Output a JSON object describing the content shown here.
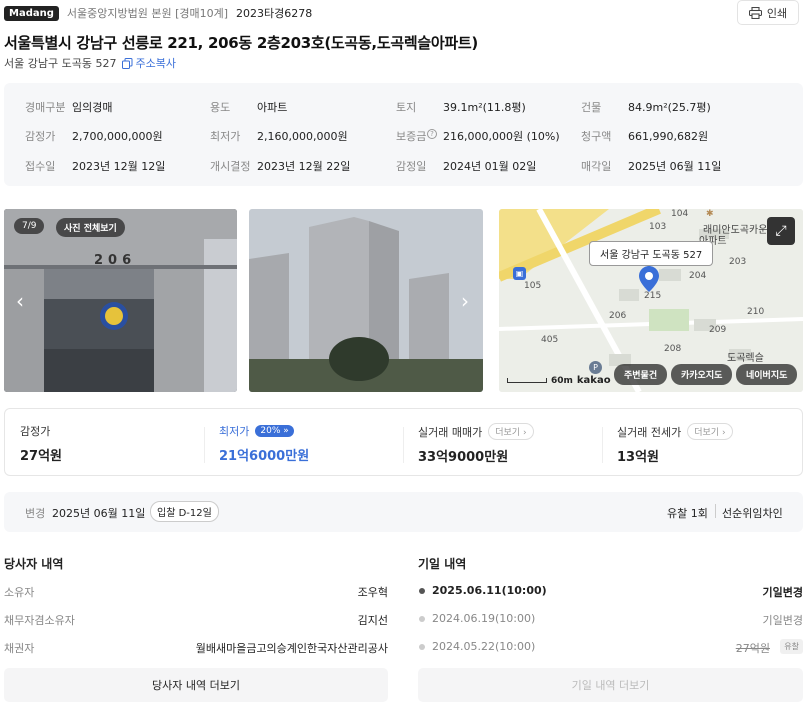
{
  "header": {
    "logo": "Madang",
    "court": "서울중앙지방법원 본원 [경매10계]",
    "case_no": "2023타경6278",
    "print_label": "인쇄",
    "title": "서울특별시 강남구 선릉로 221, 206동 2층203호(도곡동,도곡렉슬아파트)",
    "sub_address": "서울 강남구 도곡동 527",
    "copy_label": "주소복사"
  },
  "info": {
    "row1": [
      {
        "k": "경매구분",
        "v": "임의경매"
      },
      {
        "k": "용도",
        "v": "아파트"
      },
      {
        "k": "토지",
        "v": "39.1m²(11.8평)"
      },
      {
        "k": "건물",
        "v": "84.9m²(25.7평)"
      }
    ],
    "row2": [
      {
        "k": "감정가",
        "v": "2,700,000,000원"
      },
      {
        "k": "최저가",
        "v": "2,160,000,000원"
      },
      {
        "k": "보증금",
        "v": "216,000,000원 (10%)"
      },
      {
        "k": "청구액",
        "v": "661,990,682원"
      }
    ],
    "row3": [
      {
        "k": "접수일",
        "v": "2023년 12월 12일"
      },
      {
        "k": "개시결정",
        "v": "2023년 12월 22일"
      },
      {
        "k": "감정일",
        "v": "2024년 01월 02일"
      },
      {
        "k": "매각일",
        "v": "2025년 06월 11일"
      }
    ]
  },
  "gallery": {
    "counter": "7/9",
    "view_all": "사진 전체보기",
    "door_number": "206"
  },
  "map": {
    "tooltip": "서울 강남구 도곡동 527",
    "scale": "60m",
    "brand": "kakao",
    "labels": {
      "complex": "래미안도곡카운티",
      "complex2": "아파트",
      "reksl": "도곡렉슬",
      "b104": "104",
      "b103": "103",
      "b203": "203",
      "b204": "204",
      "b105": "105",
      "b206": "206",
      "b210": "210",
      "b209": "209",
      "b405": "405",
      "b208": "208",
      "b215": "215"
    },
    "buttons": {
      "nearby": "주변물건",
      "kakao_map": "카카오지도",
      "naver_map": "네이버지도"
    }
  },
  "summary": {
    "appraisal": {
      "label": "감정가",
      "value": "27억원"
    },
    "minimum": {
      "label": "최저가",
      "badge": "20%",
      "value": "21억6000만원"
    },
    "sale_price": {
      "label": "실거래 매매가",
      "more": "더보기",
      "value": "33억9000만원"
    },
    "jeonse": {
      "label": "실거래 전세가",
      "more": "더보기",
      "value": "13억원"
    }
  },
  "change": {
    "label": "변경",
    "date": "2025년 06월 11일",
    "badge": "입찰 D-12일",
    "fail": "유찰 1회",
    "priority": "선순위임차인"
  },
  "parties": {
    "title": "당사자 내역",
    "rows": [
      {
        "k": "소유자",
        "v": "조우혁"
      },
      {
        "k": "채무자겸소유자",
        "v": "김지선"
      },
      {
        "k": "채권자",
        "v": "월배새마을금고의승계인한국자산관리공사"
      }
    ],
    "more_button": "당사자 내역 더보기"
  },
  "schedule": {
    "title": "기일 내역",
    "rows": [
      {
        "date": "2025.06.11(10:00)",
        "status": "기일변경"
      },
      {
        "date": "2024.06.19(10:00)",
        "status": "기일변경"
      },
      {
        "date": "2024.05.22(10:00)",
        "status": "27억원",
        "tag": "유찰"
      }
    ],
    "more_button": "기일 내역 더보기"
  },
  "colors": {
    "accent": "#3a6fd8",
    "text": "#222222",
    "muted": "#888888",
    "panel": "#f6f7f9"
  }
}
